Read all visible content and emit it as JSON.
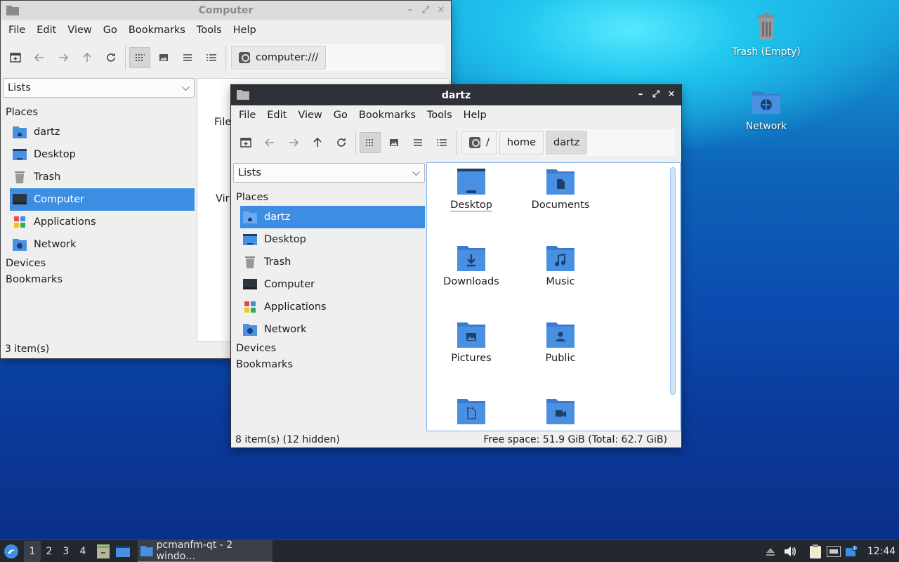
{
  "desktop": {
    "icons": [
      {
        "label": "Trash (Empty)",
        "icon": "trash-icon"
      },
      {
        "label": "Network",
        "icon": "network-folder-icon"
      }
    ]
  },
  "back_window": {
    "title": "Computer",
    "menu": [
      "File",
      "Edit",
      "View",
      "Go",
      "Bookmarks",
      "Tools",
      "Help"
    ],
    "path": "computer:///",
    "side_mode": "Lists",
    "sections": {
      "places": "Places",
      "devices": "Devices",
      "bookmarks": "Bookmarks"
    },
    "places": [
      "dartz",
      "Desktop",
      "Trash",
      "Computer",
      "Applications",
      "Network"
    ],
    "selected_place": "Computer",
    "partial_items": [
      "File",
      "Vir"
    ],
    "status": "3 item(s)"
  },
  "front_window": {
    "title": "dartz",
    "menu": [
      "File",
      "Edit",
      "View",
      "Go",
      "Bookmarks",
      "Tools",
      "Help"
    ],
    "breadcrumbs": [
      "/",
      "home",
      "dartz"
    ],
    "side_mode": "Lists",
    "sections": {
      "places": "Places",
      "devices": "Devices",
      "bookmarks": "Bookmarks"
    },
    "places": [
      "dartz",
      "Desktop",
      "Trash",
      "Computer",
      "Applications",
      "Network"
    ],
    "selected_place": "dartz",
    "files": [
      "Desktop",
      "Documents",
      "Downloads",
      "Music",
      "Pictures",
      "Public",
      "",
      ""
    ],
    "status_left": "8 item(s) (12 hidden)",
    "status_right": "Free space: 51.9 GiB (Total: 62.7 GiB)"
  },
  "taskbar": {
    "desktops": [
      "1",
      "2",
      "3",
      "4"
    ],
    "current_desktop": "1",
    "task_label": "pcmanfm-qt - 2 windo…",
    "clock": "12:44"
  },
  "colors": {
    "accent": "#3d8ee2",
    "folder": "#4a90e2",
    "taskbar": "#23272e"
  }
}
